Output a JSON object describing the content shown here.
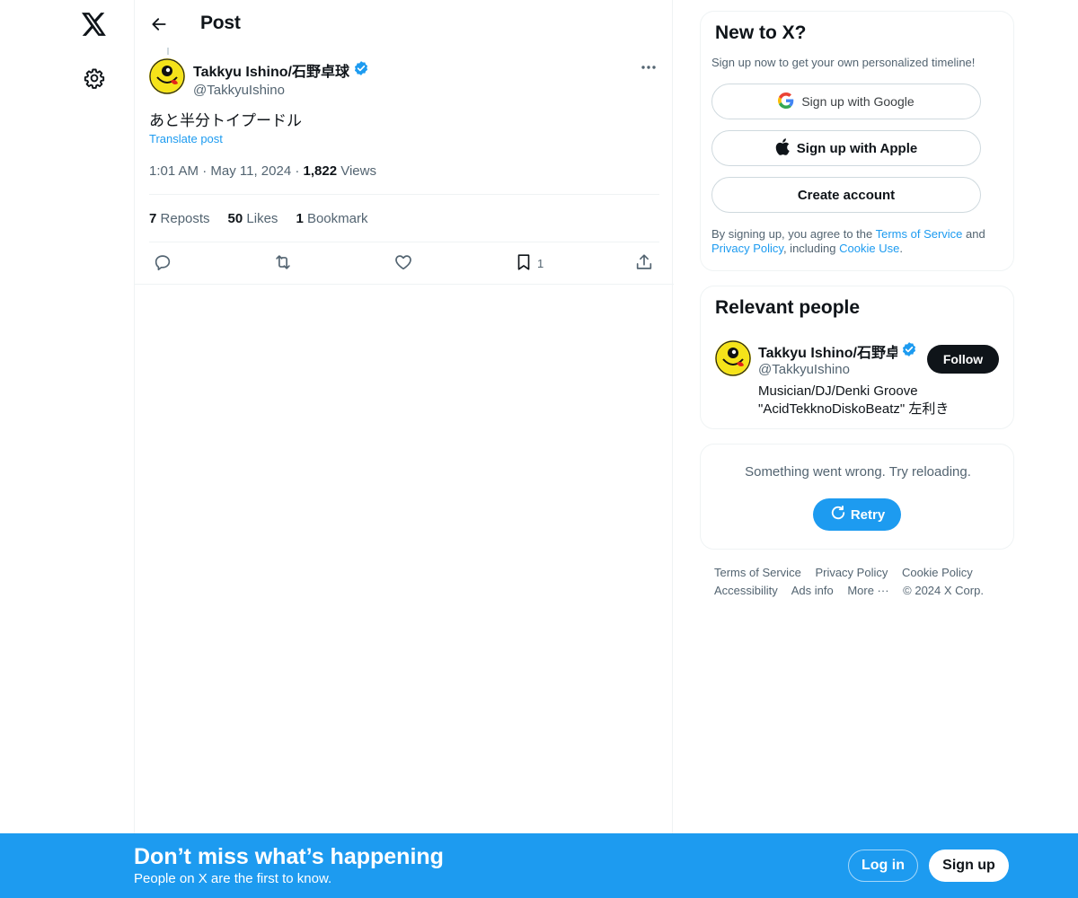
{
  "nav": {
    "logo_icon": "x-logo-icon",
    "settings_icon": "gear-icon"
  },
  "header": {
    "title": "Post"
  },
  "post": {
    "author_name": "Takkyu Ishino/石野卓球",
    "author_handle": "@TakkyuIshino",
    "verified": true,
    "text": "あと半分トイプードル",
    "translate_label": "Translate post",
    "time": "1:01 AM",
    "date": "May 11, 2024",
    "views_count": "1,822",
    "views_label": "Views",
    "stats": {
      "reposts_count": "7",
      "reposts_label": "Reposts",
      "likes_count": "50",
      "likes_label": "Likes",
      "bookmarks_count": "1",
      "bookmarks_label": "Bookmark"
    },
    "actions": {
      "bookmark_count": "1"
    }
  },
  "sidebar": {
    "new_to_x": {
      "title": "New to X?",
      "subtitle": "Sign up now to get your own personalized timeline!",
      "google_label": "Sign up with Google",
      "apple_label": "Sign up with Apple",
      "create_label": "Create account",
      "legal_prefix": "By signing up, you agree to the ",
      "terms_label": "Terms of Service",
      "legal_and": " and ",
      "privacy_label": "Privacy Policy",
      "legal_including": ", including ",
      "cookie_label": "Cookie Use",
      "legal_end": "."
    },
    "relevant_people": {
      "title": "Relevant people",
      "name": "Takkyu Ishino/石野卓球",
      "handle": "@TakkyuIshino",
      "bio": "Musician/DJ/Denki Groove \"AcidTekknoDiskoBeatz\" 左利き",
      "follow_label": "Follow"
    },
    "error": {
      "message": "Something went wrong. Try reloading.",
      "retry_label": "Retry"
    },
    "footer": {
      "terms": "Terms of Service",
      "privacy": "Privacy Policy",
      "cookie": "Cookie Policy",
      "accessibility": "Accessibility",
      "ads": "Ads info",
      "more": "More ···",
      "copyright": "© 2024 X Corp."
    }
  },
  "banner": {
    "title": "Don’t miss what’s happening",
    "subtitle": "People on X are the first to know.",
    "login_label": "Log in",
    "signup_label": "Sign up"
  },
  "colors": {
    "accent": "#1d9bf0",
    "text": "#0f1419",
    "muted": "#536471",
    "border": "#eff3f4"
  }
}
